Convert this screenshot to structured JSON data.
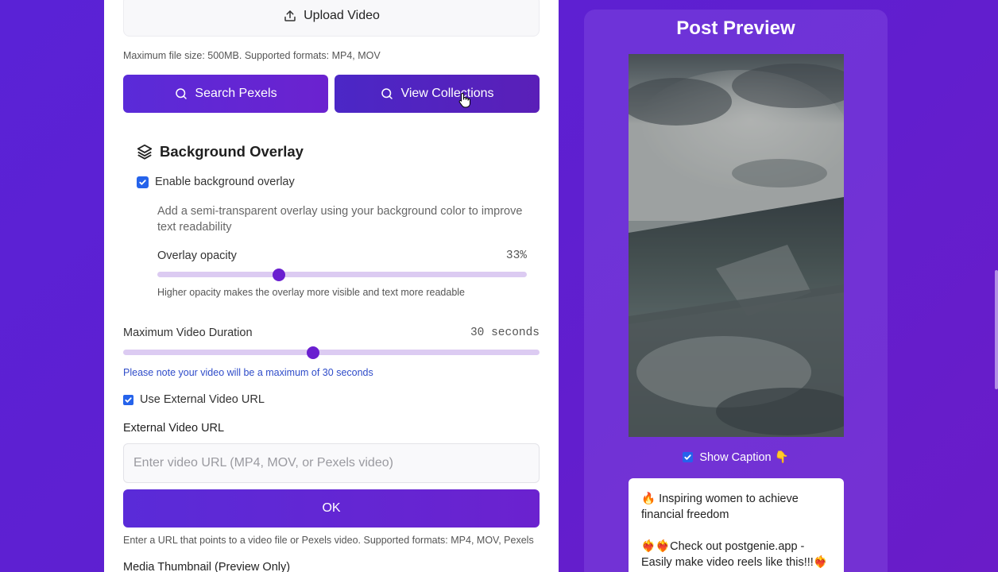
{
  "upload": {
    "label": "Upload Video",
    "hint": "Maximum file size: 500MB. Supported formats: MP4, MOV"
  },
  "actions": {
    "search_pexels": "Search Pexels",
    "view_collections": "View Collections"
  },
  "overlay": {
    "title": "Background Overlay",
    "enable_label": "Enable background overlay",
    "enabled": true,
    "description": "Add a semi-transparent overlay using your background color to improve text readability",
    "opacity_label": "Overlay opacity",
    "opacity_value": "33%",
    "opacity_fraction": 0.33,
    "opacity_note": "Higher opacity makes the overlay more visible and text more readable"
  },
  "duration": {
    "label": "Maximum Video Duration",
    "value": "30 seconds",
    "fraction": 0.457,
    "note": "Please note your video will be a maximum of 30 seconds"
  },
  "external": {
    "checkbox_label": "Use External Video URL",
    "checked": true,
    "field_label": "External Video URL",
    "placeholder": "Enter video URL (MP4, MOV, or Pexels video)",
    "ok_label": "OK",
    "hint": "Enter a URL that points to a video file or Pexels video. Supported formats: MP4, MOV, Pexels"
  },
  "thumbnail_label": "Media Thumbnail (Preview Only)",
  "preview": {
    "title": "Post Preview",
    "show_caption_label": "Show Caption 👇",
    "caption_line1": "🔥 Inspiring women to achieve financial freedom",
    "caption_line2": "❤️‍🔥❤️‍🔥Check out postgenie.app - Easily make video reels like this!!!❤️‍🔥"
  },
  "colors": {
    "accent": "#6a1fd0",
    "background": "#5a22d6",
    "checkbox": "#2563eb"
  }
}
